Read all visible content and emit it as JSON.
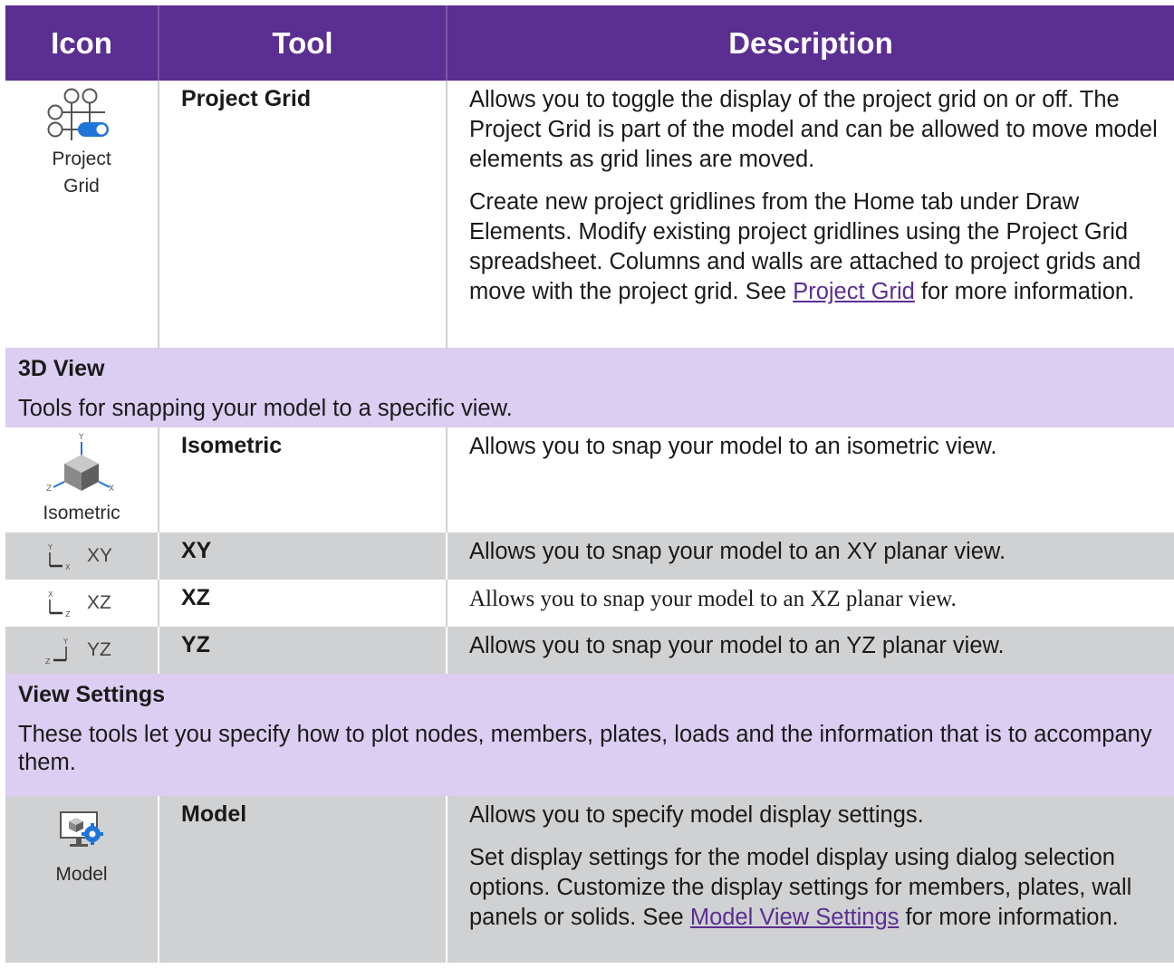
{
  "header": {
    "icon": "Icon",
    "tool": "Tool",
    "description": "Description"
  },
  "rows": {
    "project_grid": {
      "icon_label_1": "Project",
      "icon_label_2": "Grid",
      "icon": "project-grid-icon",
      "tool": "Project Grid",
      "p1": "Allows you to toggle the display of the project grid on or off. The Project Grid is part of the model and can be allowed to move model elements as grid lines are moved.",
      "p2_text": "Create new project gridlines from the Home tab under Draw Elements. Modify existing project gridlines using the Project Grid spreadsheet. Columns and walls are attached to project grids and move with the project grid. See",
      "p2_link": "Project Grid",
      "p2_tail": "for more information."
    },
    "isometric": {
      "icon_label": "Isometric",
      "icon": "isometric-cube-icon",
      "tool": "Isometric",
      "desc": "Allows you to snap your model to an isometric view."
    },
    "xy": {
      "icon_label": "XY",
      "icon": "xy-axis-icon",
      "tool": "XY",
      "desc": "Allows you to snap your model to an XY planar view."
    },
    "xz": {
      "icon_label": "XZ",
      "icon": "xz-axis-icon",
      "tool": "XZ",
      "desc": "Allows you to snap your model to an XZ planar view."
    },
    "yz": {
      "icon_label": "YZ",
      "icon": "yz-axis-icon",
      "tool": "YZ",
      "desc": "Allows you to snap your model to an YZ planar view."
    },
    "model": {
      "icon_label": "Model",
      "icon": "model-settings-icon",
      "tool": "Model",
      "p1": "Allows you to specify model display settings.",
      "p2_text": "Set display settings for the model display using dialog selection options. Customize the display settings for members, plates, wall panels or solids. See",
      "p2_link": "Model View Settings",
      "p2_tail": "for more information."
    }
  },
  "sections": {
    "view3d": {
      "title": "3D View",
      "desc": "Tools for snapping your model to a specific view."
    },
    "view_settings": {
      "title": "View Settings",
      "desc": "These tools let you specify how to plot nodes, members, plates, loads and the information that is to accompany them."
    }
  },
  "colors": {
    "header_bg": "#5b2e91",
    "section_bg": "#dccdf2",
    "gray_row": "#d0d1d3",
    "accent_blue": "#1f74d9"
  }
}
